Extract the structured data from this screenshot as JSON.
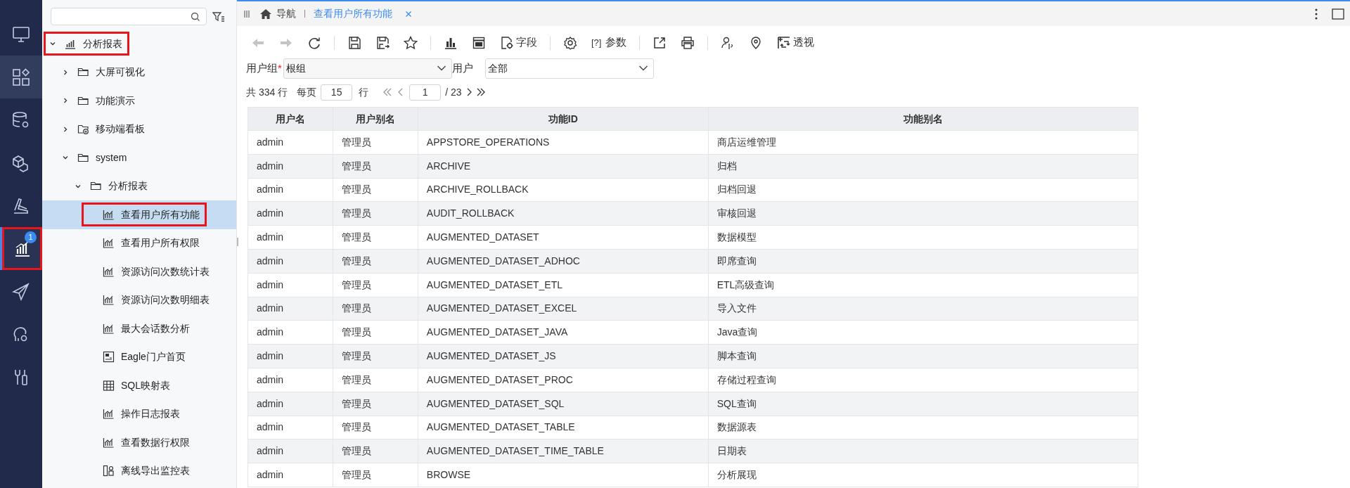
{
  "rail": [
    {
      "selected": false,
      "hovered": false,
      "highlighted": false
    },
    {
      "selected": false,
      "hovered": true,
      "highlighted": false
    },
    {
      "selected": false,
      "hovered": false,
      "highlighted": false
    },
    {
      "selected": false,
      "hovered": false,
      "highlighted": false
    },
    {
      "selected": false,
      "hovered": false,
      "highlighted": false
    },
    {
      "selected": true,
      "hovered": false,
      "badge": "1",
      "highlighted": true
    },
    {
      "selected": false,
      "hovered": false,
      "highlighted": false
    },
    {
      "selected": false,
      "hovered": false,
      "highlighted": false
    },
    {
      "selected": false,
      "hovered": false,
      "highlighted": false
    }
  ],
  "tree": [
    {
      "kind": "chart-root",
      "label": "分析报表",
      "expanded": true,
      "selected": false,
      "highlighted": true,
      "children": [
        {
          "kind": "folder",
          "label": "大屏可视化",
          "expanded": false,
          "selected": false,
          "highlighted": false
        },
        {
          "kind": "folder",
          "label": "功能演示",
          "expanded": false,
          "selected": false,
          "highlighted": false
        },
        {
          "kind": "mobile-folder",
          "label": "移动端看板",
          "expanded": false,
          "selected": false,
          "highlighted": false
        },
        {
          "kind": "folder",
          "label": "system",
          "expanded": true,
          "selected": false,
          "highlighted": false,
          "children": [
            {
              "kind": "folder",
              "label": "分析报表",
              "expanded": true,
              "selected": false,
              "highlighted": false,
              "children": [
                {
                  "kind": "report",
                  "label": "查看用户所有功能",
                  "selected": true,
                  "highlighted": true
                },
                {
                  "kind": "report",
                  "label": "查看用户所有权限",
                  "selected": false,
                  "highlighted": false
                },
                {
                  "kind": "report",
                  "label": "资源访问次数统计表",
                  "selected": false,
                  "highlighted": false
                },
                {
                  "kind": "report",
                  "label": "资源访问次数明细表",
                  "selected": false,
                  "highlighted": false
                },
                {
                  "kind": "report",
                  "label": "最大会话数分析",
                  "selected": false,
                  "highlighted": false
                },
                {
                  "kind": "portal",
                  "label": "Eagle门户首页",
                  "selected": false,
                  "highlighted": false
                },
                {
                  "kind": "table",
                  "label": "SQL映射表",
                  "selected": false,
                  "highlighted": false
                },
                {
                  "kind": "report",
                  "label": "操作日志报表",
                  "selected": false,
                  "highlighted": false
                },
                {
                  "kind": "report",
                  "label": "查看数据行权限",
                  "selected": false,
                  "highlighted": false
                },
                {
                  "kind": "monitor",
                  "label": "离线导出监控表",
                  "selected": false,
                  "highlighted": false
                }
              ]
            }
          ]
        }
      ]
    }
  ],
  "tabs": [
    {
      "label": "导航",
      "selected": false,
      "kind": "home"
    },
    {
      "label": "查看用户所有功能",
      "selected": true,
      "kind": "page"
    }
  ],
  "toolbar": [
    {
      "kind": "back",
      "disabled": true
    },
    {
      "kind": "forward",
      "disabled": true
    },
    {
      "kind": "refresh",
      "disabled": false
    },
    {
      "kind": "sep"
    },
    {
      "kind": "save",
      "disabled": false
    },
    {
      "kind": "save-as",
      "disabled": false
    },
    {
      "kind": "star",
      "disabled": false
    },
    {
      "kind": "sep"
    },
    {
      "kind": "bar-chart",
      "disabled": false
    },
    {
      "kind": "layout",
      "disabled": false
    },
    {
      "kind": "field",
      "label": "字段",
      "disabled": false
    },
    {
      "kind": "sep"
    },
    {
      "kind": "settings",
      "disabled": false
    },
    {
      "kind": "param",
      "glyph": "[?]",
      "label": "参数",
      "disabled": false
    },
    {
      "kind": "sep"
    },
    {
      "kind": "export",
      "disabled": false
    },
    {
      "kind": "print",
      "disabled": false
    },
    {
      "kind": "sep"
    },
    {
      "kind": "user-param",
      "disabled": false
    },
    {
      "kind": "location",
      "disabled": false
    },
    {
      "kind": "pivot",
      "label": "透视",
      "disabled": false
    }
  ],
  "filters": [
    {
      "label": "用户组",
      "required_mark": "*",
      "value": "根组"
    },
    {
      "label": "用户",
      "value": "全部"
    }
  ],
  "pagination": {
    "total": "共 334 行",
    "per_page_label": "每页",
    "per_page": "15",
    "rows_label": "行",
    "page": "1",
    "pages": "/ 23"
  },
  "table": {
    "columns": [
      "用户名",
      "用户别名",
      "功能ID",
      "功能别名"
    ],
    "rows": [
      [
        "admin",
        "管理员",
        "APPSTORE_OPERATIONS",
        "商店运维管理"
      ],
      [
        "admin",
        "管理员",
        "ARCHIVE",
        "归档"
      ],
      [
        "admin",
        "管理员",
        "ARCHIVE_ROLLBACK",
        "归档回退"
      ],
      [
        "admin",
        "管理员",
        "AUDIT_ROLLBACK",
        "审核回退"
      ],
      [
        "admin",
        "管理员",
        "AUGMENTED_DATASET",
        "数据模型"
      ],
      [
        "admin",
        "管理员",
        "AUGMENTED_DATASET_ADHOC",
        "即席查询"
      ],
      [
        "admin",
        "管理员",
        "AUGMENTED_DATASET_ETL",
        "ETL高级查询"
      ],
      [
        "admin",
        "管理员",
        "AUGMENTED_DATASET_EXCEL",
        "导入文件"
      ],
      [
        "admin",
        "管理员",
        "AUGMENTED_DATASET_JAVA",
        "Java查询"
      ],
      [
        "admin",
        "管理员",
        "AUGMENTED_DATASET_JS",
        "脚本查询"
      ],
      [
        "admin",
        "管理员",
        "AUGMENTED_DATASET_PROC",
        "存储过程查询"
      ],
      [
        "admin",
        "管理员",
        "AUGMENTED_DATASET_SQL",
        "SQL查询"
      ],
      [
        "admin",
        "管理员",
        "AUGMENTED_DATASET_TABLE",
        "数据源表"
      ],
      [
        "admin",
        "管理员",
        "AUGMENTED_DATASET_TIME_TABLE",
        "日期表"
      ],
      [
        "admin",
        "管理员",
        "BROWSE",
        "分析展现"
      ]
    ]
  }
}
